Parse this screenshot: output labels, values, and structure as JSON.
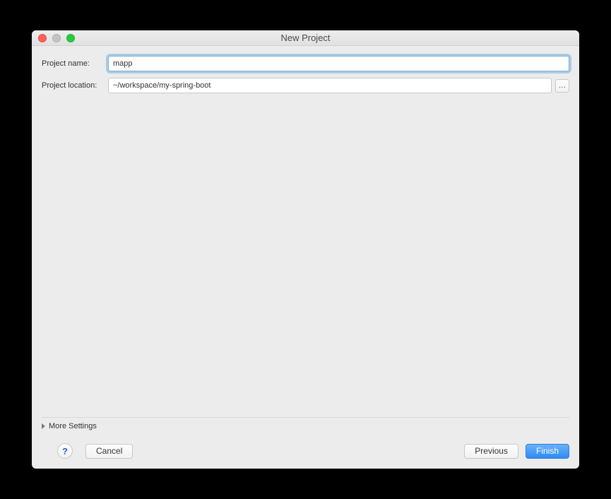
{
  "window": {
    "title": "New Project"
  },
  "form": {
    "name_label": "Project name:",
    "name_value": "mapp",
    "location_label": "Project location:",
    "location_value": "~/workspace/my-spring-boot",
    "browse_label": "…"
  },
  "more_settings": {
    "label": "More Settings"
  },
  "footer": {
    "help_label": "?",
    "cancel_label": "Cancel",
    "previous_label": "Previous",
    "finish_label": "Finish"
  }
}
